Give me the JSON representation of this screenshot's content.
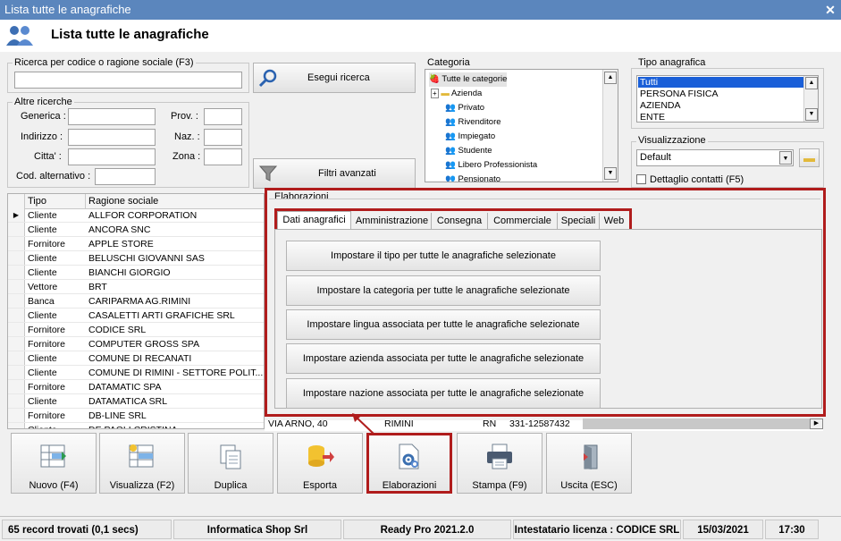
{
  "window": {
    "title": "Lista tutte le anagrafiche",
    "header_title": "Lista tutte le anagrafiche"
  },
  "search": {
    "group_label": "Ricerca per codice o ragione sociale (F3)",
    "value": "",
    "execute_label": "Esegui ricerca",
    "filters_label": "Filtri avanzati"
  },
  "other": {
    "group_label": "Altre ricerche",
    "generica": "Generica :",
    "indirizzo": "Indirizzo :",
    "citta": "Citta' :",
    "cod_alt": "Cod. alternativo :",
    "prov": "Prov. :",
    "naz": "Naz. :",
    "zona": "Zona :"
  },
  "categoria": {
    "label": "Categoria",
    "items": [
      "Tutte le categorie",
      "Azienda",
      "Privato",
      "Rivenditore",
      "Impiegato",
      "Studente",
      "Libero Professionista",
      "Pensionato"
    ]
  },
  "tipo": {
    "label": "Tipo anagrafica",
    "items": [
      "Tutti",
      "PERSONA FISICA",
      "AZIENDA",
      "ENTE"
    ]
  },
  "visual": {
    "label": "Visualizzazione",
    "selected": "Default",
    "dettaglio": "Dettaglio contatti (F5)"
  },
  "grid": {
    "col_tipo": "Tipo",
    "col_ragione": "Ragione sociale",
    "rows": [
      {
        "tipo": "Cliente",
        "ragione": "ALLFOR CORPORATION"
      },
      {
        "tipo": "Cliente",
        "ragione": "ANCORA SNC"
      },
      {
        "tipo": "Fornitore",
        "ragione": "APPLE STORE"
      },
      {
        "tipo": "Cliente",
        "ragione": "BELUSCHI GIOVANNI SAS"
      },
      {
        "tipo": "Cliente",
        "ragione": "BIANCHI GIORGIO"
      },
      {
        "tipo": "Vettore",
        "ragione": "BRT"
      },
      {
        "tipo": "Banca",
        "ragione": "CARIPARMA AG.RIMINI"
      },
      {
        "tipo": "Cliente",
        "ragione": "CASALETTI ARTI GRAFICHE SRL"
      },
      {
        "tipo": "Fornitore",
        "ragione": "CODICE SRL"
      },
      {
        "tipo": "Fornitore",
        "ragione": "COMPUTER GROSS SPA"
      },
      {
        "tipo": "Cliente",
        "ragione": "COMUNE DI RECANATI"
      },
      {
        "tipo": "Cliente",
        "ragione": "COMUNE DI RIMINI - SETTORE POLIT..."
      },
      {
        "tipo": "Fornitore",
        "ragione": "DATAMATIC SPA"
      },
      {
        "tipo": "Cliente",
        "ragione": "DATAMATICA SRL"
      },
      {
        "tipo": "Fornitore",
        "ragione": "DB-LINE SRL"
      },
      {
        "tipo": "Cliente",
        "ragione": "DE PAOLI CRISTINA"
      }
    ],
    "partial_row": {
      "addr": "VIA ARNO, 40",
      "city": "RIMINI",
      "prov": "RN",
      "phone": "331-12587432"
    }
  },
  "elab": {
    "label": "Elaborazioni",
    "tabs": [
      "Dati anagrafici",
      "Amministrazione",
      "Consegna",
      "Commerciale",
      "Speciali",
      "Web"
    ],
    "actions": [
      "Impostare il tipo per tutte le anagrafiche selezionate",
      "Impostare la categoria per tutte le anagrafiche selezionate",
      "Impostare lingua associata per tutte le anagrafiche selezionate",
      "Impostare azienda associata per tutte le anagrafiche selezionate",
      "Impostare nazione associata per tutte le anagrafiche selezionate"
    ]
  },
  "toolbar": {
    "nuovo": "Nuovo (F4)",
    "visualizza": "Visualizza (F2)",
    "duplica": "Duplica",
    "esporta": "Esporta",
    "elaborazioni": "Elaborazioni",
    "stampa": "Stampa (F9)",
    "uscita": "Uscita (ESC)"
  },
  "status": {
    "records": "65 record trovati (0,1 secs)",
    "company": "Informatica Shop Srl",
    "version": "Ready Pro 2021.2.0",
    "license": "Intestatario licenza : CODICE SRL",
    "date": "15/03/2021",
    "time": "17:30"
  },
  "colors": {
    "titlebar": "#5b86bd",
    "highlight": "#b01c1c",
    "selection": "#1a5fd8"
  }
}
